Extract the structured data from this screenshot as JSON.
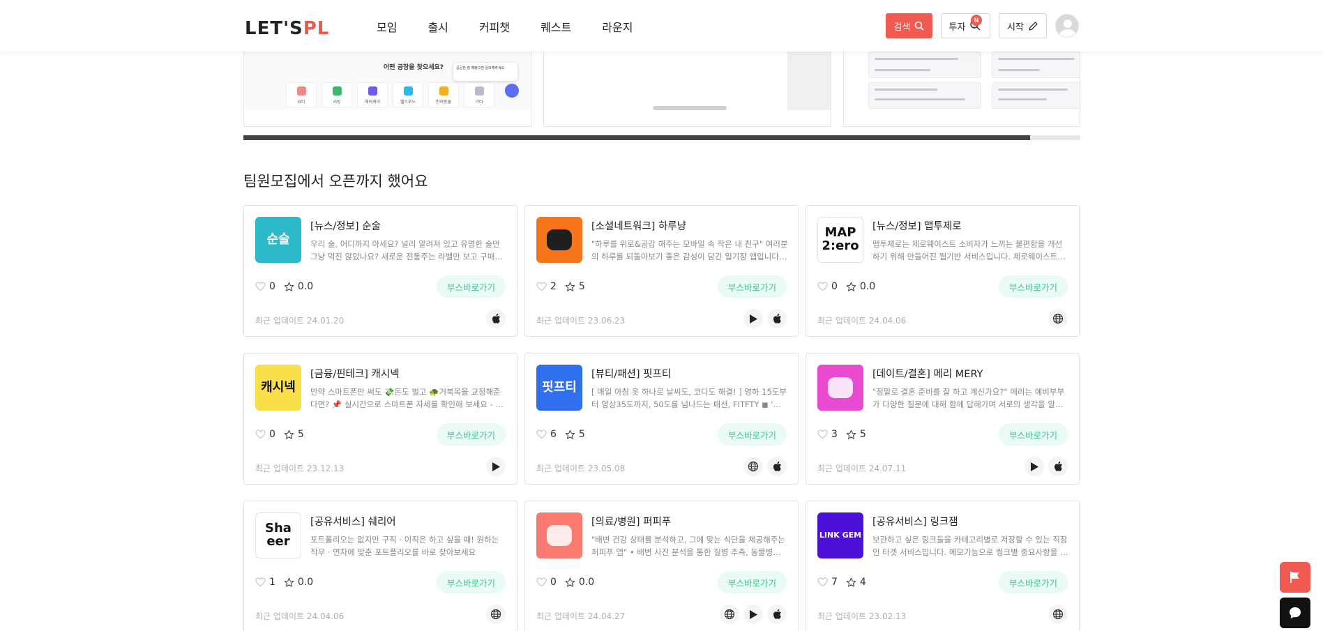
{
  "header": {
    "logo_main": "LET'S",
    "logo_accent": "PL",
    "nav": [
      "모임",
      "출시",
      "커피챗",
      "퀘스트",
      "라운지"
    ],
    "search_label": "검색",
    "invest_label": "투자",
    "invest_badge": "N",
    "start_label": "시작"
  },
  "carousel": {
    "slide1_title": "어떤 공장을 찾으세요?",
    "slide1_icons": [
      "뷰티",
      "리빙",
      "헤어케어",
      "헬스푸드",
      "반려동물",
      "기타"
    ],
    "slide1_popup": "공공한 점 해봤으면 문의해주세요",
    "progress": 0.94
  },
  "section": {
    "title": "팀원모집에서 오픈까지 했어요",
    "booth_label": "부스바로가기",
    "updated_prefix": "최근 업데이트"
  },
  "cards": [
    {
      "title": "[뉴스/정보] 순술",
      "desc": "우리 술, 어디까지 아세요? 널리 알려져 있고 유명한 술만 그냥 먹진 않았나요? 새로운 전통주는 라벨만 보고 구매하진 않았나요?",
      "likes": "0",
      "rating": "0.0",
      "updated": "최근 업데이트 24.01.20",
      "platforms": [
        "apple"
      ],
      "thumb_text": "순술",
      "thumb_bg": "#2bb8c9"
    },
    {
      "title": "[소셜네트워크] 하루냥",
      "desc": "\"하루를 위로&공감 해주는 모바일 속 작은 내 친구\" 여러분의 하루를 되돌아보기 좋은 감성이 담긴 일기장 앱입니다. 일기를 쓰면",
      "likes": "2",
      "rating": "5",
      "updated": "최근 업데이트 23.06.23",
      "platforms": [
        "play",
        "apple"
      ],
      "thumb_text": "",
      "thumb_bg": "#f7761b"
    },
    {
      "title": "[뉴스/정보] 맵투제로",
      "desc": "맵투제로는 제로웨이스트 소비자가 느끼는 불편함을 개선하기 위해 만들어진 웹기반 서비스입니다. 제로웨이스트샵의 재고를",
      "likes": "0",
      "rating": "0.0",
      "updated": "최근 업데이트 24.04.06",
      "platforms": [
        "web"
      ],
      "thumb_text": "MAP 2:ero",
      "thumb_bg": "#ffffff"
    },
    {
      "title": "[금융/핀테크] 캐시넥",
      "desc": "만약 스마트폰만 써도 💸돈도 벌고 🐢거북목을 교정해준다면? 📌 실시간으로 스마트폰 자세를 확인해 보세요 - 스마트폰",
      "likes": "0",
      "rating": "5",
      "updated": "최근 업데이트 23.12.13",
      "platforms": [
        "play"
      ],
      "thumb_text": "캐시넥",
      "thumb_bg": "#f9e04b"
    },
    {
      "title": "[뷰티/패션] 핏프티",
      "desc": "[ 매일 아침 옷 하나로 날씨도, 코디도 해결! ] 영하 15도부터 영상35도까지, 50도를 넘나드는 패션, FITFTY ◼ '오늘의",
      "likes": "6",
      "rating": "5",
      "updated": "최근 업데이트 23.05.08",
      "platforms": [
        "web",
        "apple"
      ],
      "thumb_text": "핏프티",
      "thumb_bg": "#2f6ff0"
    },
    {
      "title": "[데이트/결혼] 메리 MERY",
      "desc": "\"정말로 결혼 준비를 잘 하고 계신가요?\" 메리는 예비부부가 다양한 질문에 대해 함께 답해가며 서로의 생각을 알아보고",
      "likes": "3",
      "rating": "5",
      "updated": "최근 업데이트 24.07.11",
      "platforms": [
        "play",
        "apple"
      ],
      "thumb_text": "",
      "thumb_bg": "#e94bd0"
    },
    {
      "title": "[공유서비스] 쉐리어",
      "desc": "포트폴리오는 없지만 구직 · 이직은 하고 싶을 때! 원하는 직무 · 연차에 맞춘 포트폴리오를 바로 찾아보세요",
      "likes": "1",
      "rating": "0.0",
      "updated": "최근 업데이트 24.04.06",
      "platforms": [
        "web"
      ],
      "thumb_text": "Sha eer",
      "thumb_bg": "#ffffff"
    },
    {
      "title": "[의료/병원] 퍼피푸",
      "desc": "\"배변 건강 상태를 분석하고, 그에 맞는 식단을 제공해주는 퍼피푸 앱\" • 배변 사진 분석을 통한 질병 추측, 동물병원 내원",
      "likes": "0",
      "rating": "0.0",
      "updated": "최근 업데이트 24.04.27",
      "platforms": [
        "web",
        "play",
        "apple"
      ],
      "thumb_text": "",
      "thumb_bg": "#f87a70"
    },
    {
      "title": "[공유서비스] 링크잼",
      "desc": "보관하고 싶은 링크들을 카테고리별로 저장할 수 있는 직장인 타겟 서비스입니다. 메모기능으로 링크별 중요사항을 적어",
      "likes": "7",
      "rating": "4",
      "updated": "최근 업데이트 23.02.13",
      "platforms": [
        "web"
      ],
      "thumb_text": "LINK GEM",
      "thumb_bg": "#4b0fd8"
    }
  ]
}
